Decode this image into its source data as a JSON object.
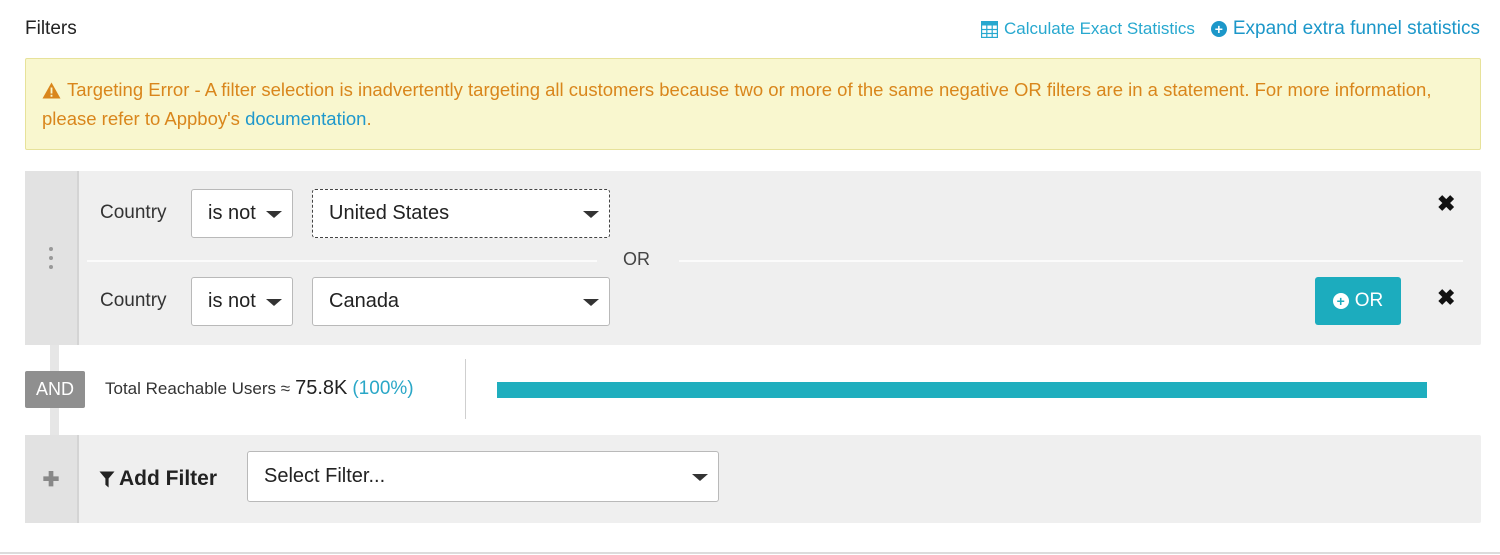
{
  "header": {
    "title": "Filters",
    "calculate_label": "Calculate Exact Statistics",
    "expand_label": "Expand extra funnel statistics"
  },
  "warning": {
    "text": "Targeting Error - A filter selection is inadvertently targeting all customers because two or more of the same negative OR filters are in a statement. For more information, please refer to Appboy's ",
    "link_text": "documentation",
    "trailing": ".",
    "color": "#d9861c"
  },
  "filter_group": {
    "rows": [
      {
        "label": "Country",
        "operator": "is not",
        "value": "United States"
      },
      {
        "label": "Country",
        "operator": "is not",
        "value": "Canada"
      }
    ],
    "or_separator": "OR",
    "or_button_label": "OR",
    "remove_glyph": "✖"
  },
  "and_label": "AND",
  "stats": {
    "label": "Total Reachable Users ≈",
    "count": "75.8K",
    "percent": "(100%)",
    "reach_fraction": 1.0,
    "bar_color": "#1faebe"
  },
  "add_filter": {
    "label": "Add Filter",
    "placeholder": "Select Filter...",
    "plus_glyph": "✚"
  },
  "colors": {
    "accent": "#1cacbe",
    "link": "#1c97c9",
    "warning_bg": "#f9f7cf"
  }
}
